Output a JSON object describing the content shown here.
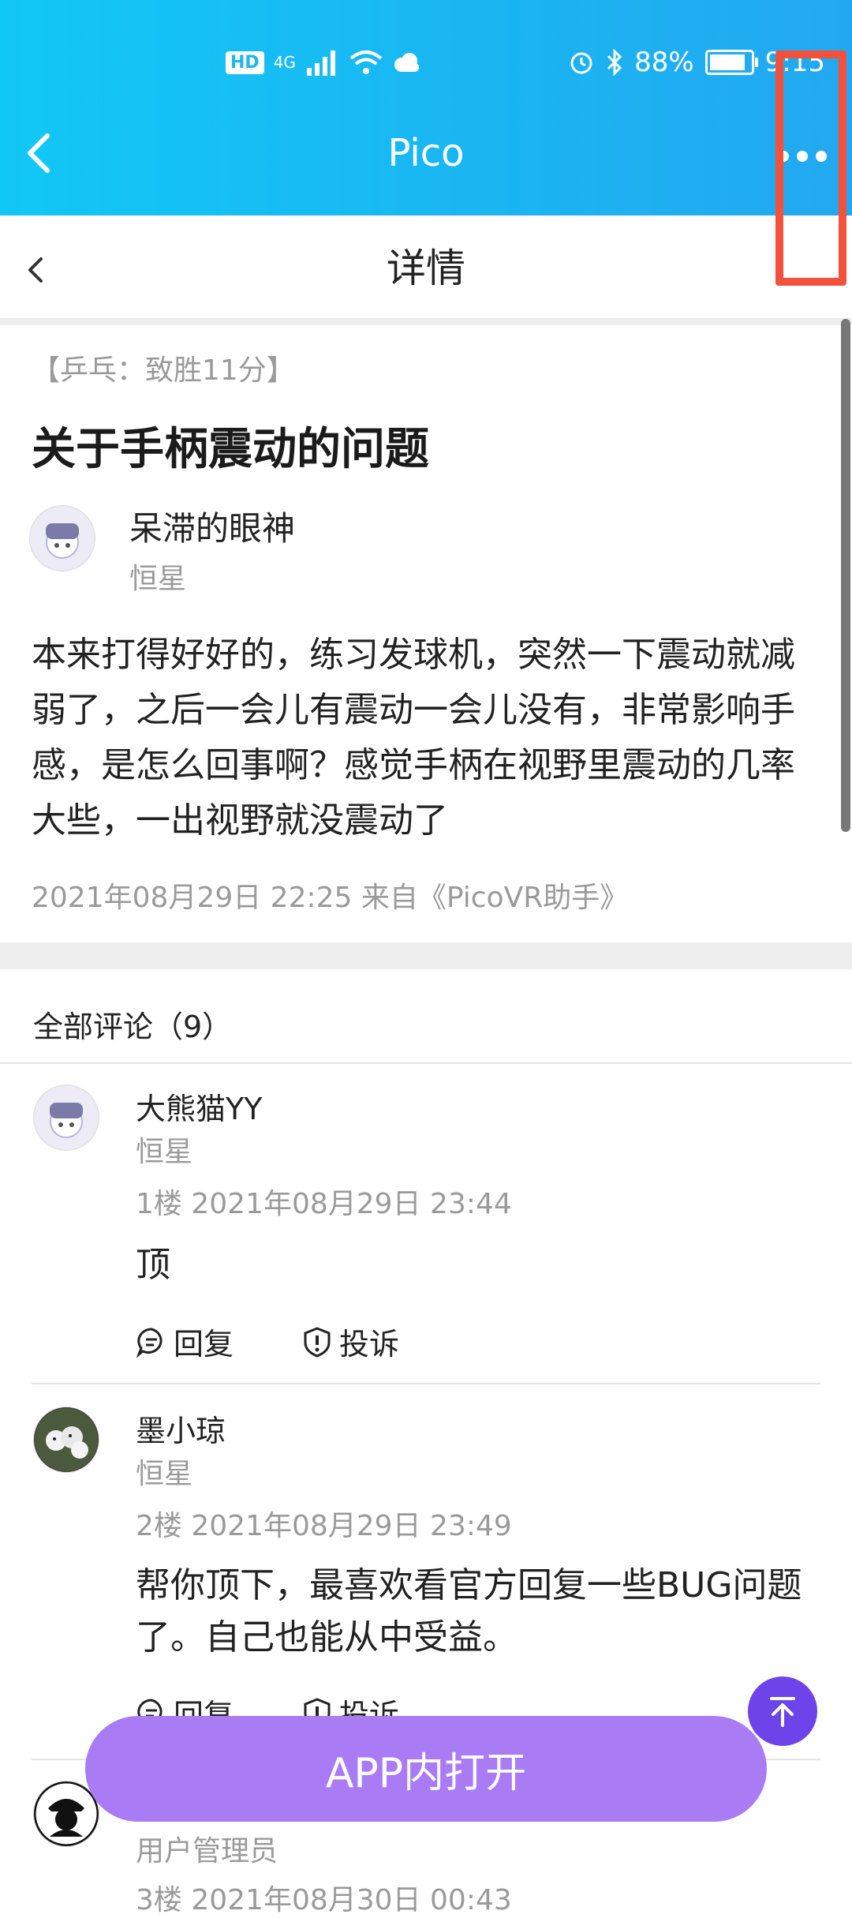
{
  "status_bar": {
    "network": "HD",
    "signal_label": "4G",
    "battery_percent": "88%",
    "time": "9:15"
  },
  "app_bar": {
    "title": "Pico"
  },
  "page_header": {
    "title": "详情"
  },
  "post": {
    "tag": "【乒乓：致胜11分】",
    "title": "关于手柄震动的问题",
    "author": {
      "name": "呆滞的眼神",
      "role": "恒星"
    },
    "body": "本来打得好好的，练习发球机，突然一下震动就减弱了，之后一会儿有震动一会儿没有，非常影响手感，是怎么回事啊？感觉手柄在视野里震动的几率大些，一出视野就没震动了",
    "meta": "2021年08月29日 22:25   来自《PicoVR助手》"
  },
  "comments_section": {
    "title": "全部评论（9）",
    "comments": [
      {
        "name": "大熊猫YY",
        "role": "恒星",
        "meta": "1楼   2021年08月29日 23:44",
        "body": "顶",
        "reply_label": "回复",
        "report_label": "投诉"
      },
      {
        "name": "墨小琼",
        "role": "恒星",
        "meta": "2楼   2021年08月29日 23:49",
        "body": "帮你顶下，最喜欢看官方回复一些BUG问题了。自己也能从中受益。",
        "reply_label": "回复",
        "report_label": "投诉"
      },
      {
        "name": "",
        "role": "用户管理员",
        "meta": "3楼   2021年08月30日 00:43"
      }
    ]
  },
  "actions": {
    "open_app_label": "APP内打开"
  },
  "colors": {
    "header_blue": "#22a8f0",
    "open_app_purple": "#a97bf4",
    "scroll_top_purple": "#6c44e9",
    "highlight_red": "#f4513c"
  }
}
